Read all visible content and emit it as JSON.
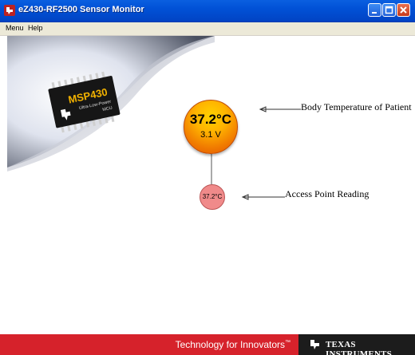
{
  "window": {
    "title": "eZ430-RF2500 Sensor Monitor"
  },
  "menubar": {
    "items": [
      "Menu",
      "Help"
    ]
  },
  "banner": {
    "chip_brand": "MSP430",
    "chip_line1": "Ultra-Low-Power",
    "chip_line2": "MCU"
  },
  "sensor": {
    "temperature": "37.2°C",
    "voltage": "3.1 V",
    "label": "Body Temperature of Patient"
  },
  "access_point": {
    "temperature": "37.2°C",
    "label": "Access Point Reading"
  },
  "footer": {
    "tagline": "Technology for Innovators",
    "tagline_mark": "™",
    "brand": "TEXAS INSTRUMENTS"
  }
}
